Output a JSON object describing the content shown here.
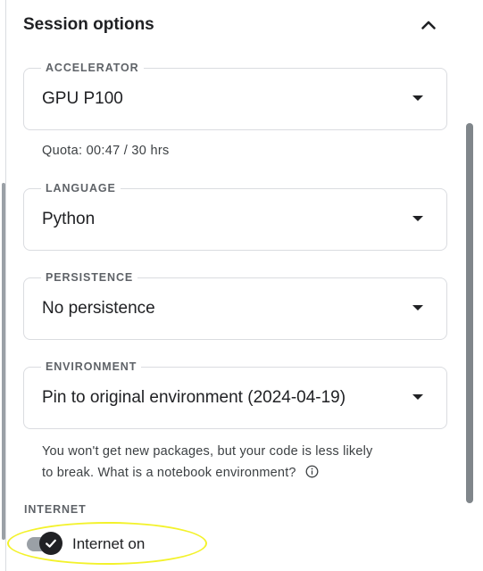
{
  "panel": {
    "title": "Session options",
    "collapse_icon": "chevron-up-icon"
  },
  "accelerator": {
    "label": "ACCELERATOR",
    "value": "GPU P100",
    "quota": "Quota: 00:47 / 30 hrs"
  },
  "language": {
    "label": "LANGUAGE",
    "value": "Python"
  },
  "persistence": {
    "label": "PERSISTENCE",
    "value": "No persistence"
  },
  "environment": {
    "label": "ENVIRONMENT",
    "value": "Pin to original environment (2024-04-19)",
    "note_line1": "You won't get new packages, but your code is less likely",
    "note_line2": "to break.",
    "note_link": "What is a notebook environment?",
    "info_icon": "info-icon"
  },
  "internet": {
    "label": "INTERNET",
    "toggle_label": "Internet on",
    "enabled": true
  },
  "colors": {
    "accent_dark": "#202124",
    "border": "#dadce0",
    "muted_text": "#5f6368",
    "toggle_track": "#9aa0a6",
    "highlight": "#f3f22b"
  }
}
